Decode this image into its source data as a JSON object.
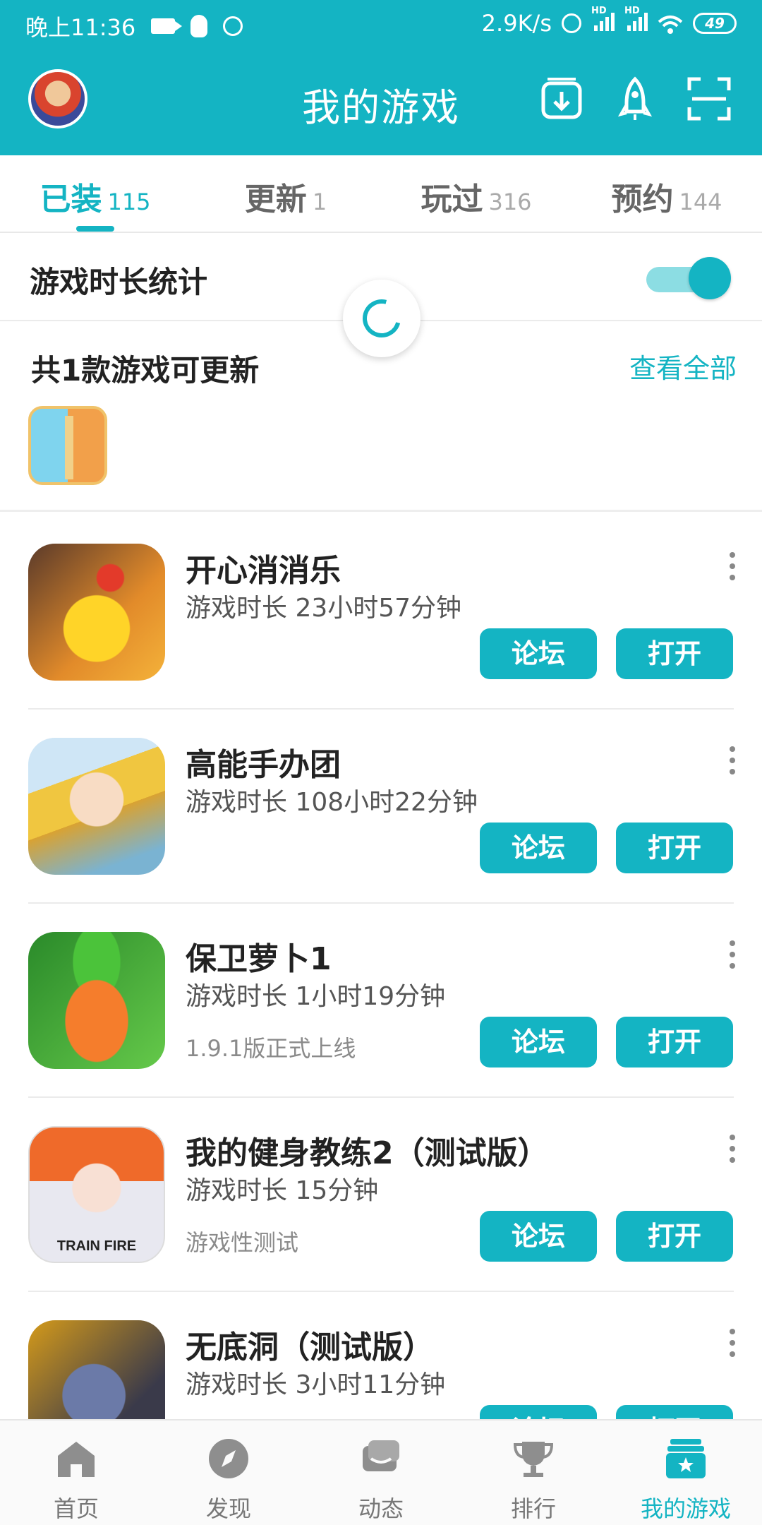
{
  "status_bar": {
    "time": "晚上11:36",
    "network_speed": "2.9K/s",
    "signal_label": "HD",
    "battery": "49"
  },
  "header": {
    "title": "我的游戏",
    "icons": [
      "avatar",
      "download-manager-icon",
      "rocket-icon",
      "scan-icon"
    ]
  },
  "tabs": [
    {
      "label": "已装",
      "count": "115",
      "active": true
    },
    {
      "label": "更新",
      "count": "1",
      "active": false
    },
    {
      "label": "玩过",
      "count": "316",
      "active": false
    },
    {
      "label": "预约",
      "count": "144",
      "active": false
    }
  ],
  "stats": {
    "label": "游戏时长统计",
    "toggle_on": true
  },
  "updates": {
    "label": "共1款游戏可更新",
    "view_all": "查看全部"
  },
  "games": [
    {
      "name": "开心消消乐",
      "duration": "游戏时长 23小时57分钟",
      "note": "",
      "forum": "论坛",
      "open": "打开"
    },
    {
      "name": "高能手办团",
      "duration": "游戏时长 108小时22分钟",
      "note": "",
      "forum": "论坛",
      "open": "打开"
    },
    {
      "name": "保卫萝卜1",
      "duration": "游戏时长 1小时19分钟",
      "note": "1.9.1版正式上线",
      "forum": "论坛",
      "open": "打开"
    },
    {
      "name": "我的健身教练2（测试版）",
      "duration": "游戏时长 15分钟",
      "note": "游戏性测试",
      "forum": "论坛",
      "open": "打开",
      "icon_text": "TRAIN FIRE"
    },
    {
      "name": "无底洞（测试版）",
      "duration": "游戏时长 3小时11分钟",
      "note": "",
      "forum": "论坛",
      "open": "打开"
    }
  ],
  "bottom_nav": [
    {
      "label": "首页",
      "icon": "home-icon"
    },
    {
      "label": "发现",
      "icon": "compass-icon"
    },
    {
      "label": "动态",
      "icon": "chat-icon"
    },
    {
      "label": "排行",
      "icon": "trophy-icon"
    },
    {
      "label": "我的游戏",
      "icon": "my-games-icon",
      "active": true
    }
  ],
  "colors": {
    "accent": "#14b4c3",
    "toggle_track": "#8cdde3"
  }
}
